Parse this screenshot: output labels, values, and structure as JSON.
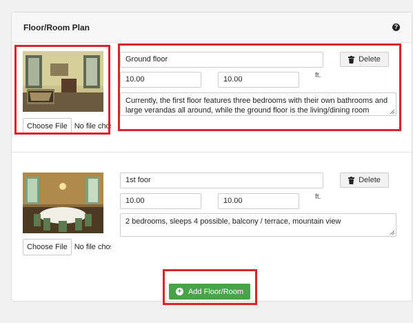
{
  "panel": {
    "title": "Floor/Room Plan",
    "help_icon": "question-circle-icon"
  },
  "rooms": [
    {
      "name": "Ground floor",
      "width": "10.00",
      "length": "10.00",
      "unit": "ft.",
      "description": "Currently, the first floor features three bedrooms with their own bathrooms and large verandas all around, while the ground floor is the living/dining room",
      "file_button": "Choose File",
      "file_status": "No file chosen",
      "delete_label": "Delete"
    },
    {
      "name": "1st foor",
      "width": "10.00",
      "length": "10.00",
      "unit": "ft.",
      "description": "2 bedrooms, sleeps 4 possible, balcony / terrace, mountain view",
      "file_button": "Choose File",
      "file_status": "No file chosen",
      "delete_label": "Delete"
    }
  ],
  "add_button": {
    "label": "Add Floor/Room",
    "icon": "plus-circle-icon"
  },
  "colors": {
    "accent_green": "#4aa24a",
    "highlight_red": "#d9242a"
  }
}
